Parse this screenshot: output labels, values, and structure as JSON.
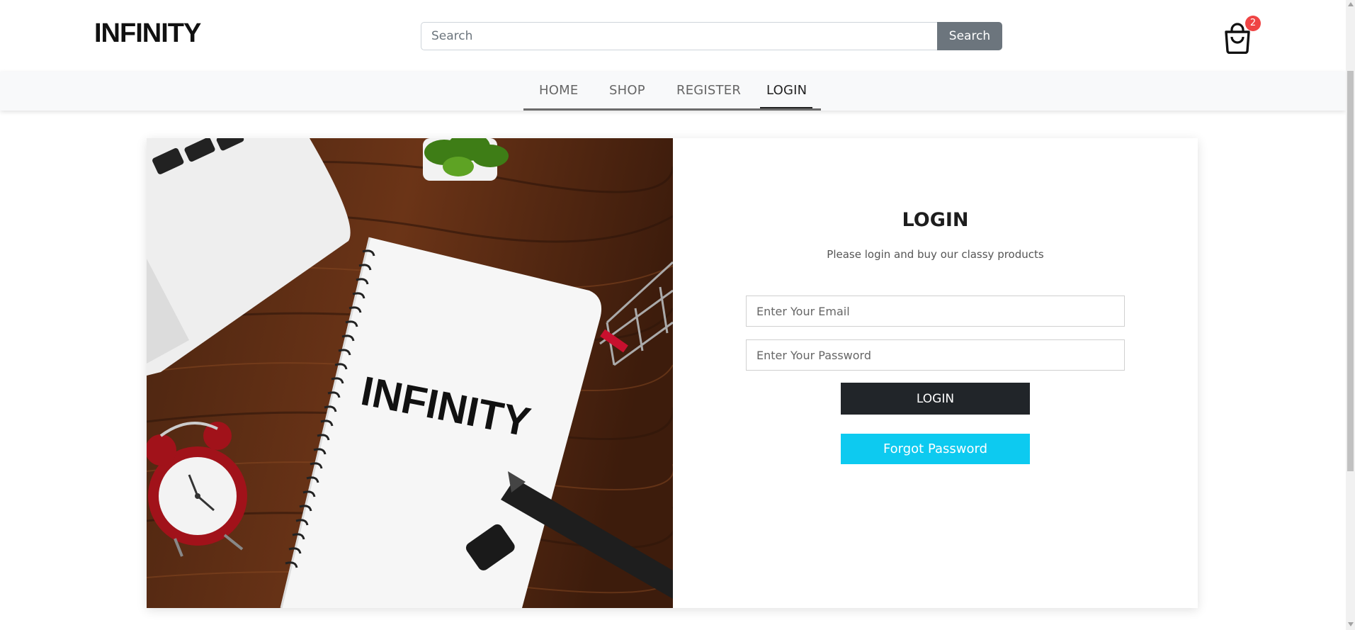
{
  "header": {
    "brand": "INFINITY",
    "search": {
      "placeholder": "Search",
      "value": "",
      "button_label": "Search"
    },
    "cart": {
      "icon": "shopping-bag-icon",
      "count": "2"
    }
  },
  "nav": {
    "items": [
      {
        "label": "HOME"
      },
      {
        "label": "SHOP"
      },
      {
        "label": "REGISTER"
      },
      {
        "label": "LOGIN",
        "active": true
      }
    ]
  },
  "hero": {
    "notebook_text": "INFINITY"
  },
  "login": {
    "title": "LOGIN",
    "subtitle": "Please login and buy our classy products",
    "email_placeholder": "Enter Your Email",
    "password_placeholder": "Enter Your Password",
    "login_button": "LOGIN",
    "forgot_button": "Forgot Password"
  },
  "colors": {
    "search_button": "#6c757d",
    "login_button": "#212529",
    "forgot_button": "#0dcaf0",
    "badge": "#ef4444",
    "nav_bg": "#f8f9fa"
  }
}
